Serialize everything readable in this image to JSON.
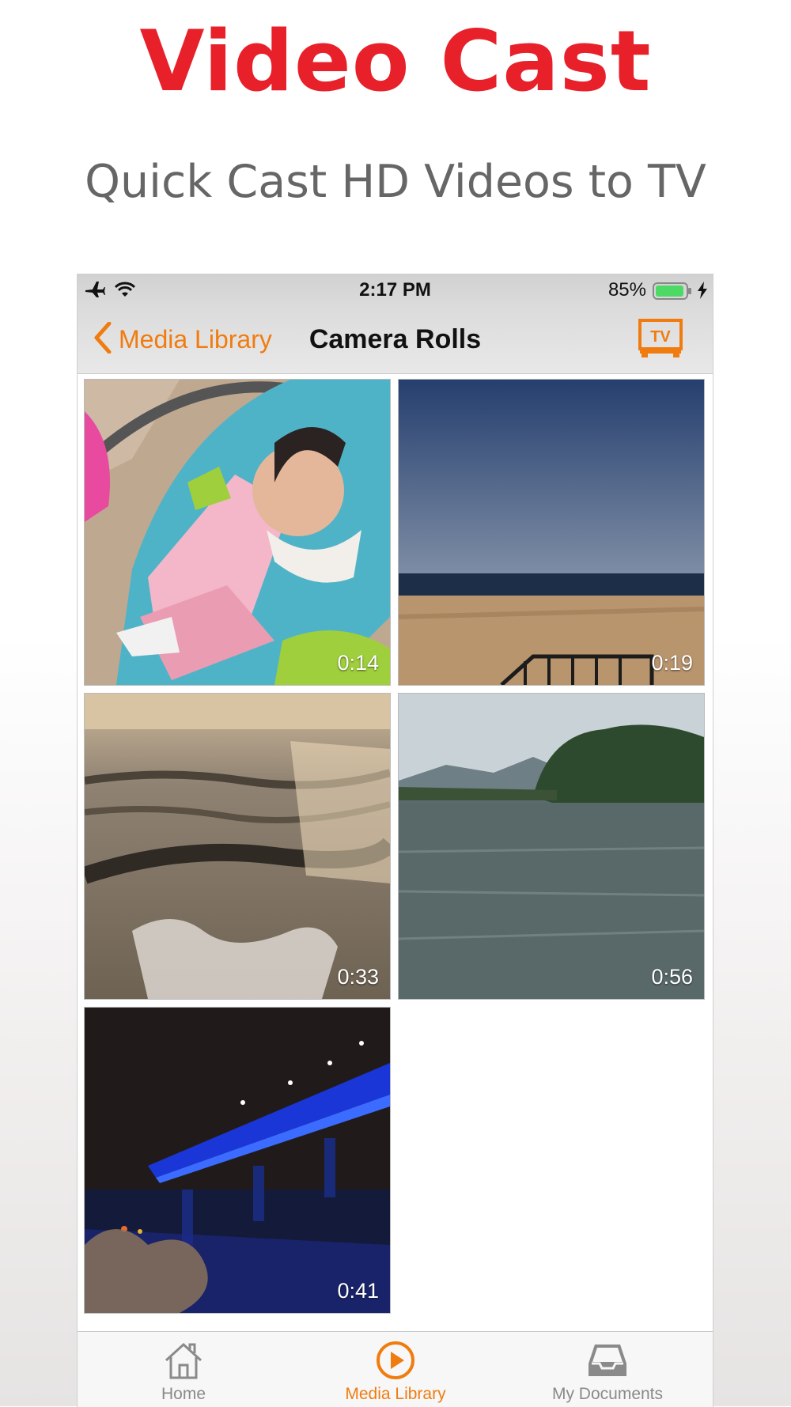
{
  "promo": {
    "title": "Video Cast",
    "subtitle": "Quick Cast HD Videos to TV"
  },
  "status_bar": {
    "time": "2:17 PM",
    "battery": "85%"
  },
  "nav": {
    "back_label": "Media Library",
    "title": "Camera Rolls",
    "cast_label": "TV"
  },
  "videos": [
    {
      "duration": "0:14",
      "scene": "baby"
    },
    {
      "duration": "0:19",
      "scene": "beach"
    },
    {
      "duration": "0:33",
      "scene": "sunset-waves"
    },
    {
      "duration": "0:56",
      "scene": "lake"
    },
    {
      "duration": "0:41",
      "scene": "night-bridge"
    }
  ],
  "tabs": [
    {
      "label": "Home",
      "icon": "home-icon",
      "active": false
    },
    {
      "label": "Media Library",
      "icon": "play-circle-icon",
      "active": true
    },
    {
      "label": "My Documents",
      "icon": "inbox-tray-icon",
      "active": false
    }
  ],
  "colors": {
    "brand_red": "#e8202a",
    "accent_orange": "#f07c10",
    "battery_green": "#4cd964"
  }
}
